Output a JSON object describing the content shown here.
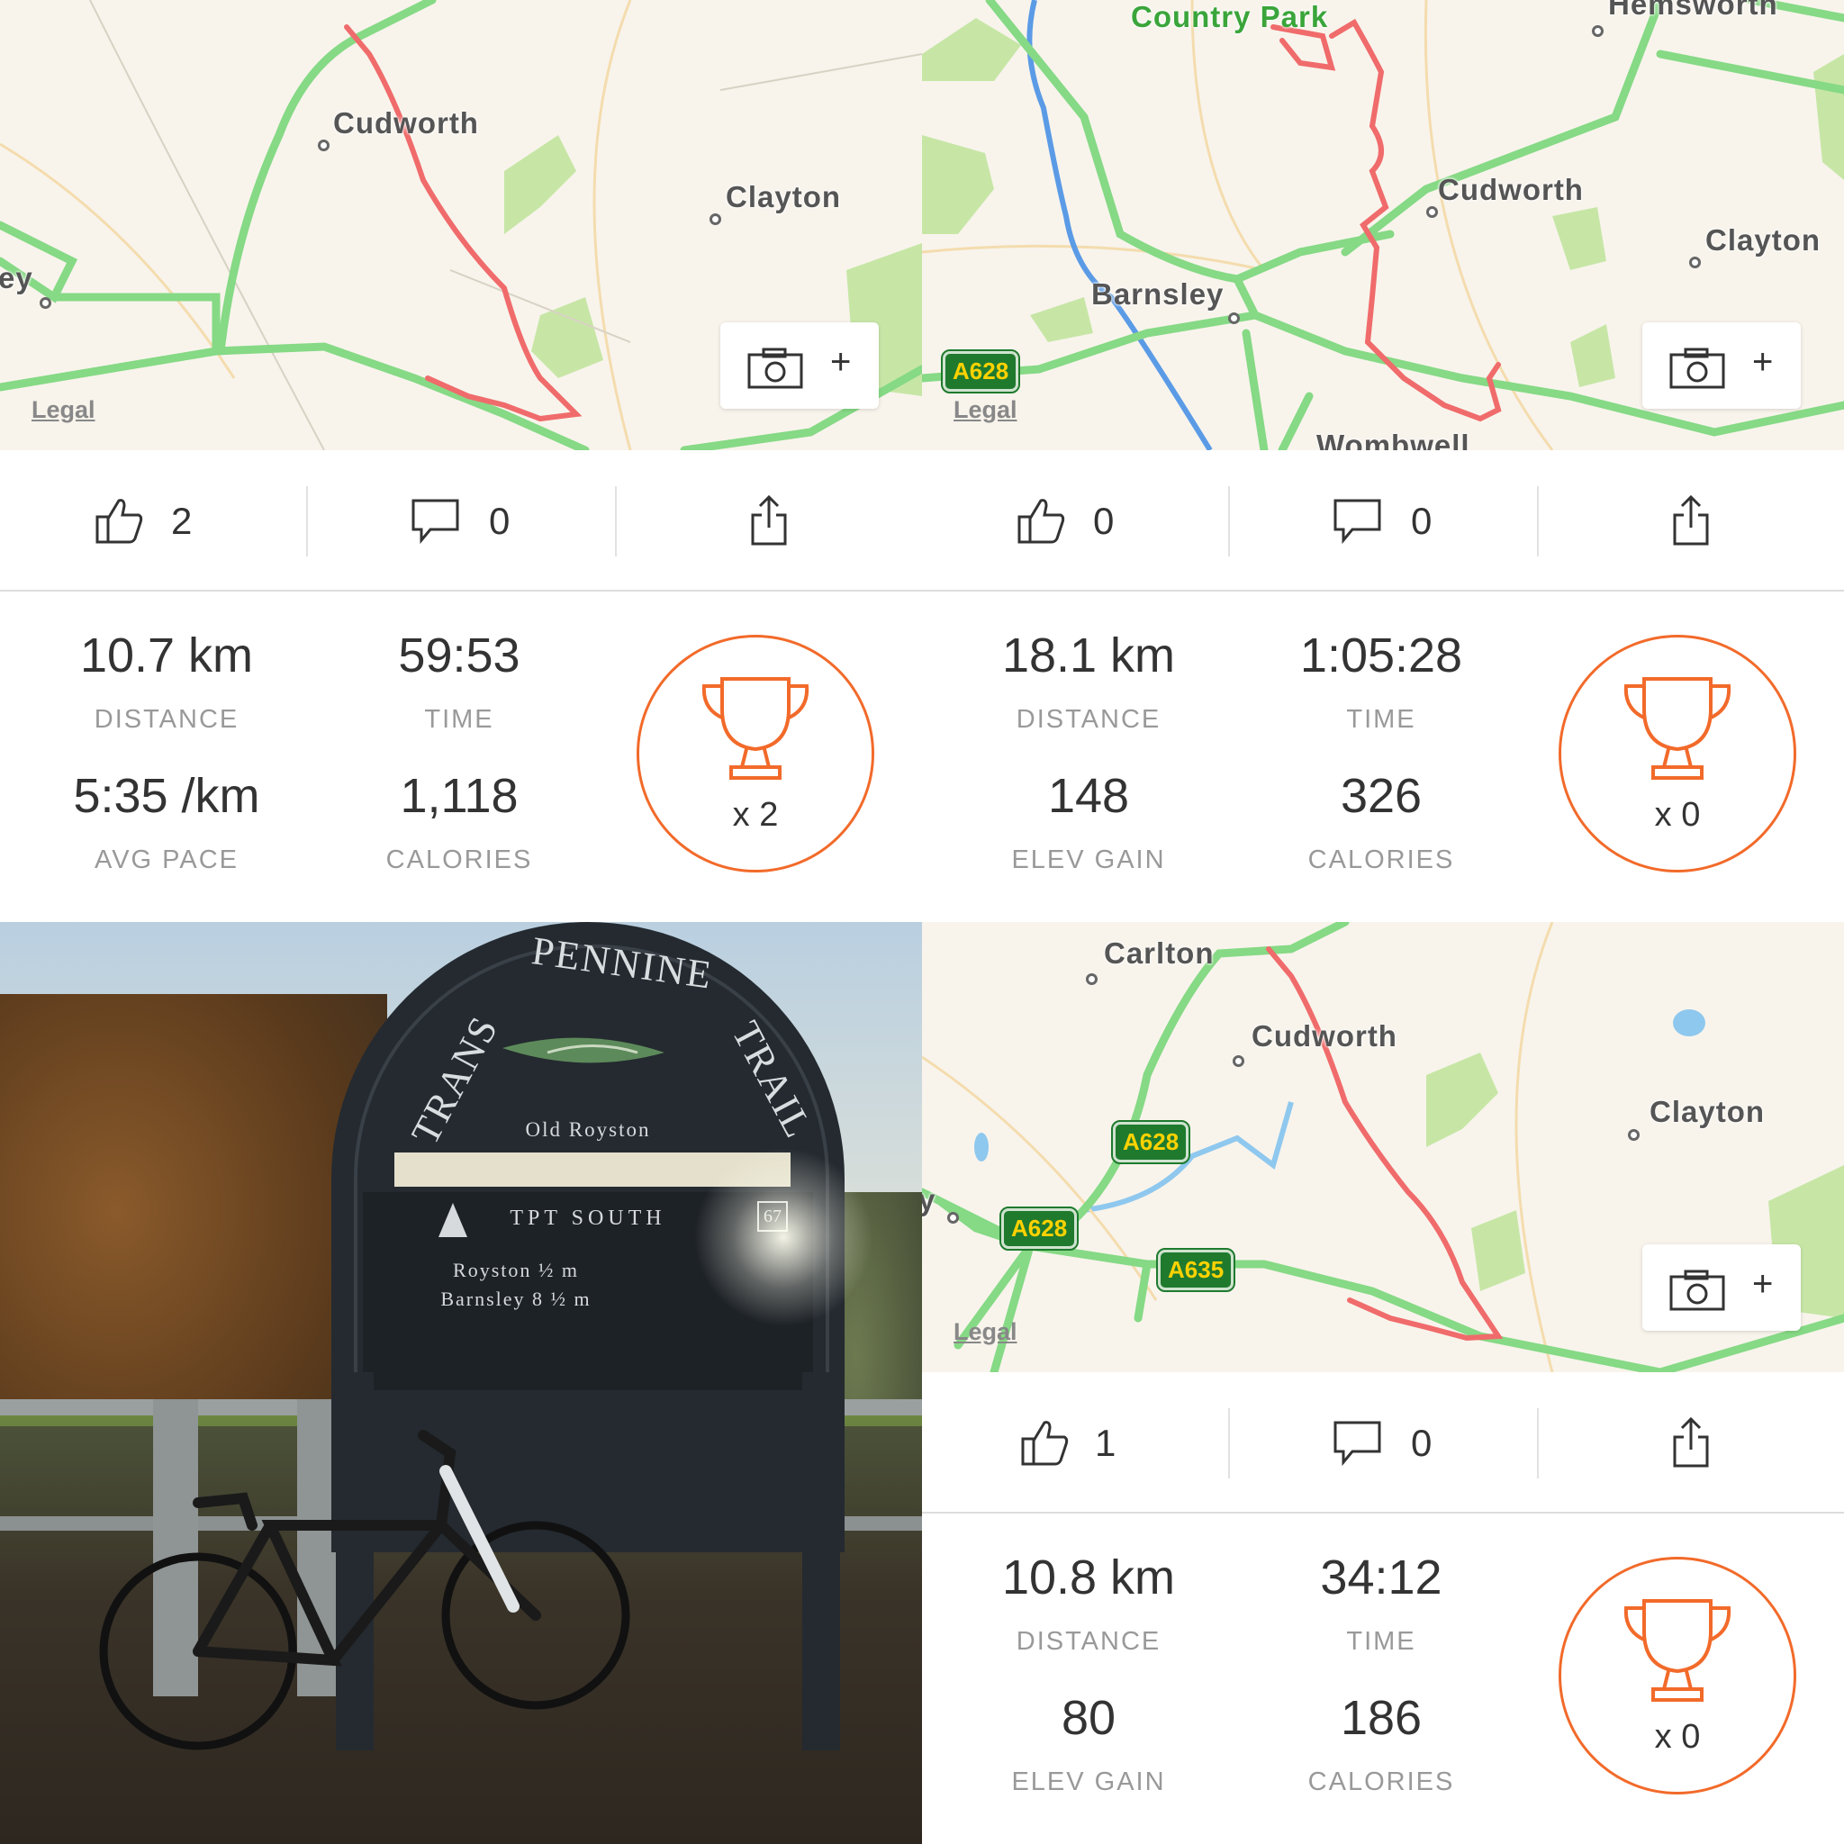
{
  "panels": [
    {
      "map": {
        "places": [
          "Cudworth",
          "Clayton",
          "ey"
        ],
        "legal": "Legal"
      },
      "social": {
        "likes": "2",
        "comments": "0"
      },
      "stats": {
        "v1": "10.7 km",
        "l1": "DISTANCE",
        "v2": "59:53",
        "l2": "TIME",
        "v3": "5:35 /km",
        "l3": "AVG PACE",
        "v4": "1,118",
        "l4": "CALORIES"
      },
      "trophy": "x 2"
    },
    {
      "map": {
        "places": [
          "Country Park",
          "Hemsworth",
          "Cudworth",
          "Clayton",
          "Barnsley",
          "Wombwell"
        ],
        "roads": [
          "A628"
        ],
        "legal": "Legal"
      },
      "social": {
        "likes": "0",
        "comments": "0"
      },
      "stats": {
        "v1": "18.1 km",
        "l1": "DISTANCE",
        "v2": "1:05:28",
        "l2": "TIME",
        "v3": "148",
        "l3": "ELEV GAIN",
        "v4": "326",
        "l4": "CALORIES"
      },
      "trophy": "x 0"
    },
    {
      "photo": {
        "sign_top": "PENNINE",
        "sign_left": "TRANS",
        "sign_right": "TRAIL",
        "sign_place": "Old Royston",
        "sign_direction": "TPT SOUTH",
        "sign_number": "67",
        "sign_line1": "Royston ½ m",
        "sign_line2": "Barnsley 8 ½ m"
      }
    },
    {
      "map": {
        "places": [
          "Carlton",
          "Cudworth",
          "Clayton",
          "y"
        ],
        "roads": [
          "A628",
          "A628",
          "A635"
        ],
        "legal": "Legal"
      },
      "social": {
        "likes": "1",
        "comments": "0"
      },
      "stats": {
        "v1": "10.8 km",
        "l1": "DISTANCE",
        "v2": "34:12",
        "l2": "TIME",
        "v3": "80",
        "l3": "ELEV GAIN",
        "v4": "186",
        "l4": "CALORIES"
      },
      "trophy": "x 0"
    }
  ],
  "colors": {
    "route": "#f06b6b",
    "road_major": "#7fd67f",
    "river": "#5b9be6",
    "park": "#c7e6a6",
    "accent": "#f26a2a",
    "map_bg": "#f8f4ec"
  },
  "icons": [
    "thumbs-up-icon",
    "comment-icon",
    "share-icon",
    "camera-icon",
    "trophy-icon"
  ]
}
